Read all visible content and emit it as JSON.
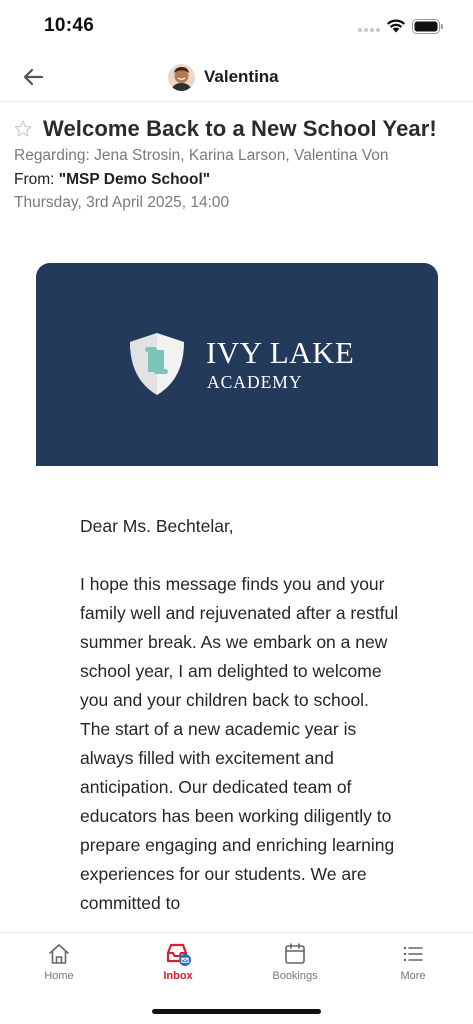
{
  "status_bar": {
    "time": "10:46"
  },
  "header": {
    "user_name": "Valentina"
  },
  "message": {
    "subject": "Welcome Back to a New School Year!",
    "regarding": "Regarding: Jena Strosin, Karina Larson, Valentina Von",
    "from_label": "From: ",
    "sender": "\"MSP Demo School\"",
    "date": "Thursday, 3rd April 2025, 14:00",
    "banner": {
      "title": "IVY LAKE",
      "subtitle": "ACADEMY",
      "background": "#243a5a",
      "shield_color": "#f2f2f2",
      "scroll_color": "#7cc4b7"
    },
    "greeting": "Dear Ms. Bechtelar,",
    "paragraphs": [
      "I hope this message finds you and your family well and rejuvenated after a restful summer break. As we embark on a new school year, I am delighted to welcome you and your children back to school.",
      "The start of a new academic year is always filled with excitement and anticipation. Our dedicated team of educators has been working diligently to prepare engaging and enriching learning experiences for our students. We are committed to"
    ]
  },
  "tab_bar": {
    "active_color": "#d6202f",
    "tabs": [
      {
        "label": "Home",
        "icon": "home-icon"
      },
      {
        "label": "Inbox",
        "icon": "inbox-icon"
      },
      {
        "label": "Bookings",
        "icon": "calendar-icon"
      },
      {
        "label": "More",
        "icon": "menu-list-icon"
      }
    ]
  }
}
